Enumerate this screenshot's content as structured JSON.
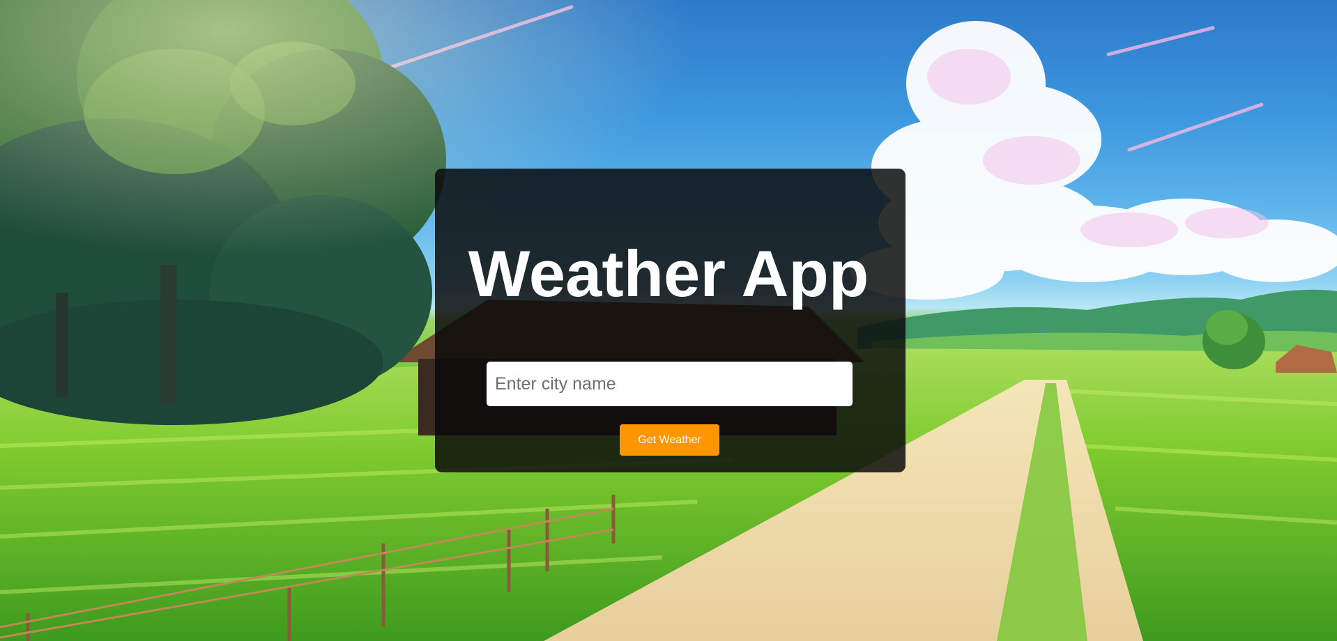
{
  "app": {
    "title": "Weather App"
  },
  "search": {
    "placeholder": "Enter city name",
    "value": ""
  },
  "actions": {
    "get_weather_label": "Get Weather"
  },
  "colors": {
    "card_background": "#0a0a0a",
    "button_accent": "#ff9500",
    "title_text": "#ffffff",
    "input_background": "#ffffff"
  },
  "background": {
    "description_icon": "landscape-illustration"
  }
}
